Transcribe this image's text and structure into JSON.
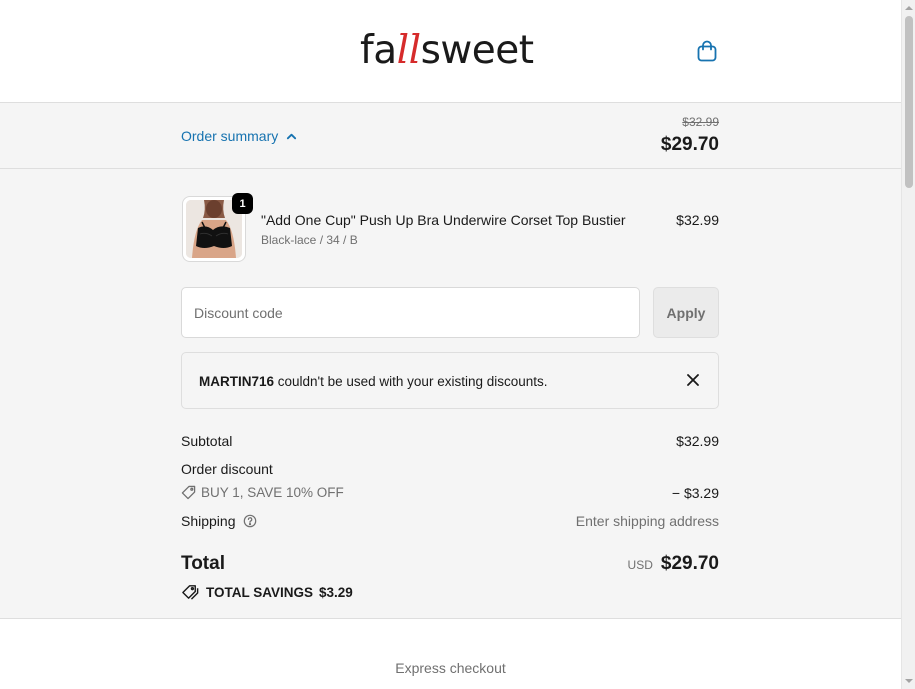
{
  "header": {
    "logo_prefix": "fa",
    "logo_accent": "ll",
    "logo_suffix": "sweet",
    "cart_icon": "shopping-bag-icon"
  },
  "summary_bar": {
    "toggle_label": "Order summary",
    "original_total": "$32.99",
    "total": "$29.70"
  },
  "line_item": {
    "quantity": "1",
    "title": "\"Add One Cup\" Push Up Bra Underwire Corset Top Bustier",
    "variant": "Black-lace / 34 / B",
    "price": "$32.99"
  },
  "discount": {
    "placeholder": "Discount code",
    "apply_label": "Apply"
  },
  "alert": {
    "code": "MARTIN716",
    "message": " couldn't be used with your existing discounts."
  },
  "totals": {
    "subtotal_label": "Subtotal",
    "subtotal_value": "$32.99",
    "order_discount_label": "Order discount",
    "discount_name": "BUY 1, SAVE 10% OFF",
    "discount_value": "− $3.29",
    "shipping_label": "Shipping",
    "shipping_value": "Enter shipping address",
    "total_label": "Total",
    "currency": "USD",
    "total_value": "$29.70",
    "savings_label": "TOTAL SAVINGS",
    "savings_value": "$3.29"
  },
  "express": {
    "label": "Express checkout"
  },
  "colors": {
    "accent_link": "#1773b0",
    "logo_accent": "#d62b2b",
    "panel_bg": "#f5f5f5"
  }
}
